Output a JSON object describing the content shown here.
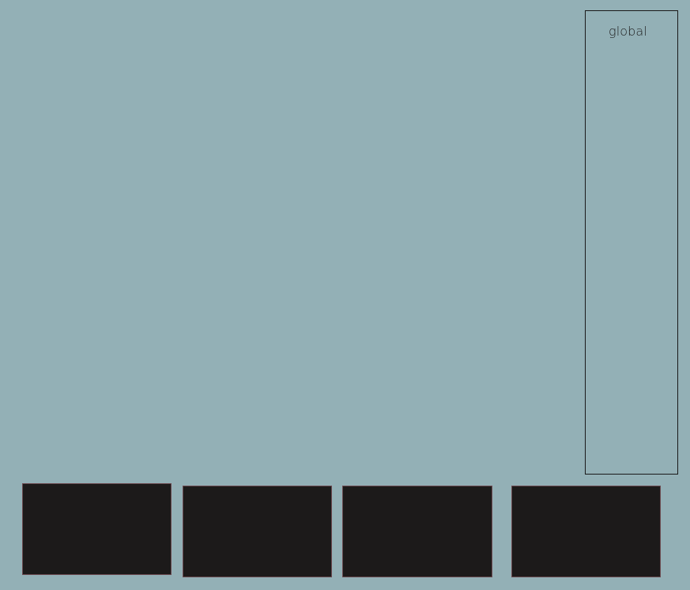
{
  "colors": {
    "background": "#93b0b6",
    "panel_border": "#1a1a1a",
    "tile_fill": "#1c1a1a"
  },
  "panel": {
    "label": "global"
  },
  "tiles": [
    {
      "id": "tile-1"
    },
    {
      "id": "tile-2"
    },
    {
      "id": "tile-3"
    },
    {
      "id": "tile-4"
    }
  ]
}
